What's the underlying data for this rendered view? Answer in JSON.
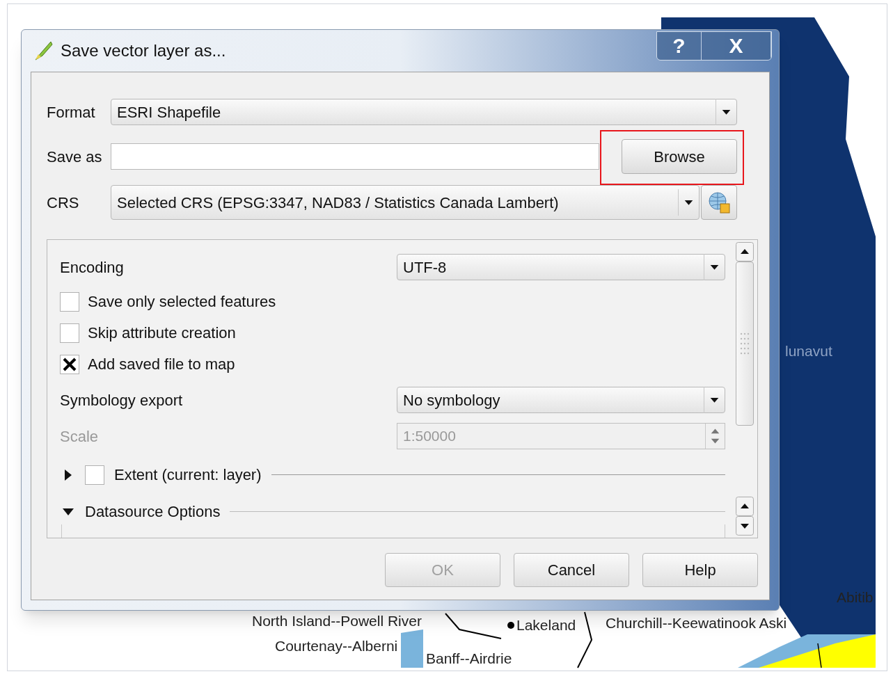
{
  "window": {
    "title": "Save vector layer as...",
    "title_buttons": [
      {
        "kind": "help",
        "label": "?"
      },
      {
        "kind": "close",
        "label": "X"
      }
    ]
  },
  "format": {
    "label": "Format",
    "value": "ESRI Shapefile"
  },
  "save_as": {
    "label": "Save as",
    "browse": {
      "label": "Browse",
      "highlighted": true
    }
  },
  "crs": {
    "label": "CRS",
    "value": "Selected CRS (EPSG:3347, NAD83 / Statistics Canada Lambert)"
  },
  "options": {
    "encoding": {
      "label": "Encoding",
      "value": "UTF-8"
    },
    "checkboxes": [
      {
        "label": "Save only selected features",
        "checked": false
      },
      {
        "label": "Skip attribute creation",
        "checked": false
      },
      {
        "label": "Add saved file to map",
        "checked": true
      }
    ],
    "symbology": {
      "label": "Symbology export",
      "value": "No symbology"
    },
    "scale": {
      "label": "Scale",
      "value": "1:50000",
      "disabled": true
    },
    "extent": {
      "label": "Extent (current: layer)",
      "expanded": false,
      "checked": false
    },
    "datasource": {
      "label": "Datasource Options",
      "expanded": true
    }
  },
  "buttons": [
    {
      "label": "OK",
      "disabled": true
    },
    {
      "label": "Cancel",
      "disabled": false
    },
    {
      "label": "Help",
      "disabled": false
    }
  ],
  "map_labels": [
    "lunavut",
    "North Island--Powell River",
    "Courtenay--Alberni",
    "Lakeland",
    "Banff--Airdrie",
    "Churchill--Keewatinook Aski",
    "Abitib"
  ]
}
